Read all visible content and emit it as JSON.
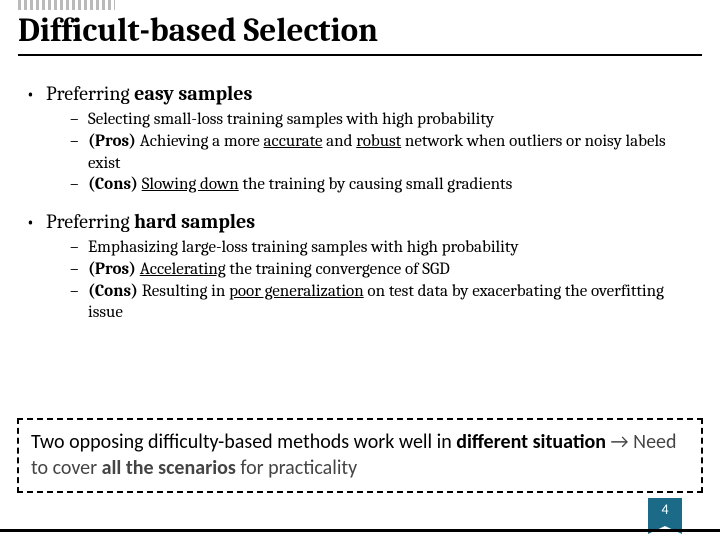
{
  "title": "Difficult-based Selection",
  "section1": {
    "heading_prefix": "Preferring ",
    "heading_bold": "easy samples",
    "items": {
      "a": "Selecting small-loss training samples with high probability",
      "b_pre": "(Pros)",
      "b_mid1": " Achieving a more ",
      "b_u1": "accurate",
      "b_mid2": " and ",
      "b_u2": "robust",
      "b_post": " network when outliers or noisy labels exist",
      "c_pre": "(Cons) ",
      "c_u": " Slowing down",
      "c_post": " the training by causing small gradients"
    }
  },
  "section2": {
    "heading_prefix": "Preferring ",
    "heading_bold": "hard samples",
    "items": {
      "a": "Emphasizing large-loss training samples with high probability",
      "b_pre": "(Pros)",
      "b_mid": " ",
      "b_u": "Accelerating",
      "b_post": " the training convergence of SGD",
      "c_pre": "(Cons)",
      "c_mid": " Resulting in ",
      "c_u": "poor generalization",
      "c_post": " on test data by exacerbating the overfitting issue"
    }
  },
  "callout": {
    "t1": "Two opposing difficulty-based methods work well in ",
    "b1": "different situation",
    "t2": " → Need to cover ",
    "b2": "all the scenarios",
    "t3": " for practicality"
  },
  "page_number": "4"
}
